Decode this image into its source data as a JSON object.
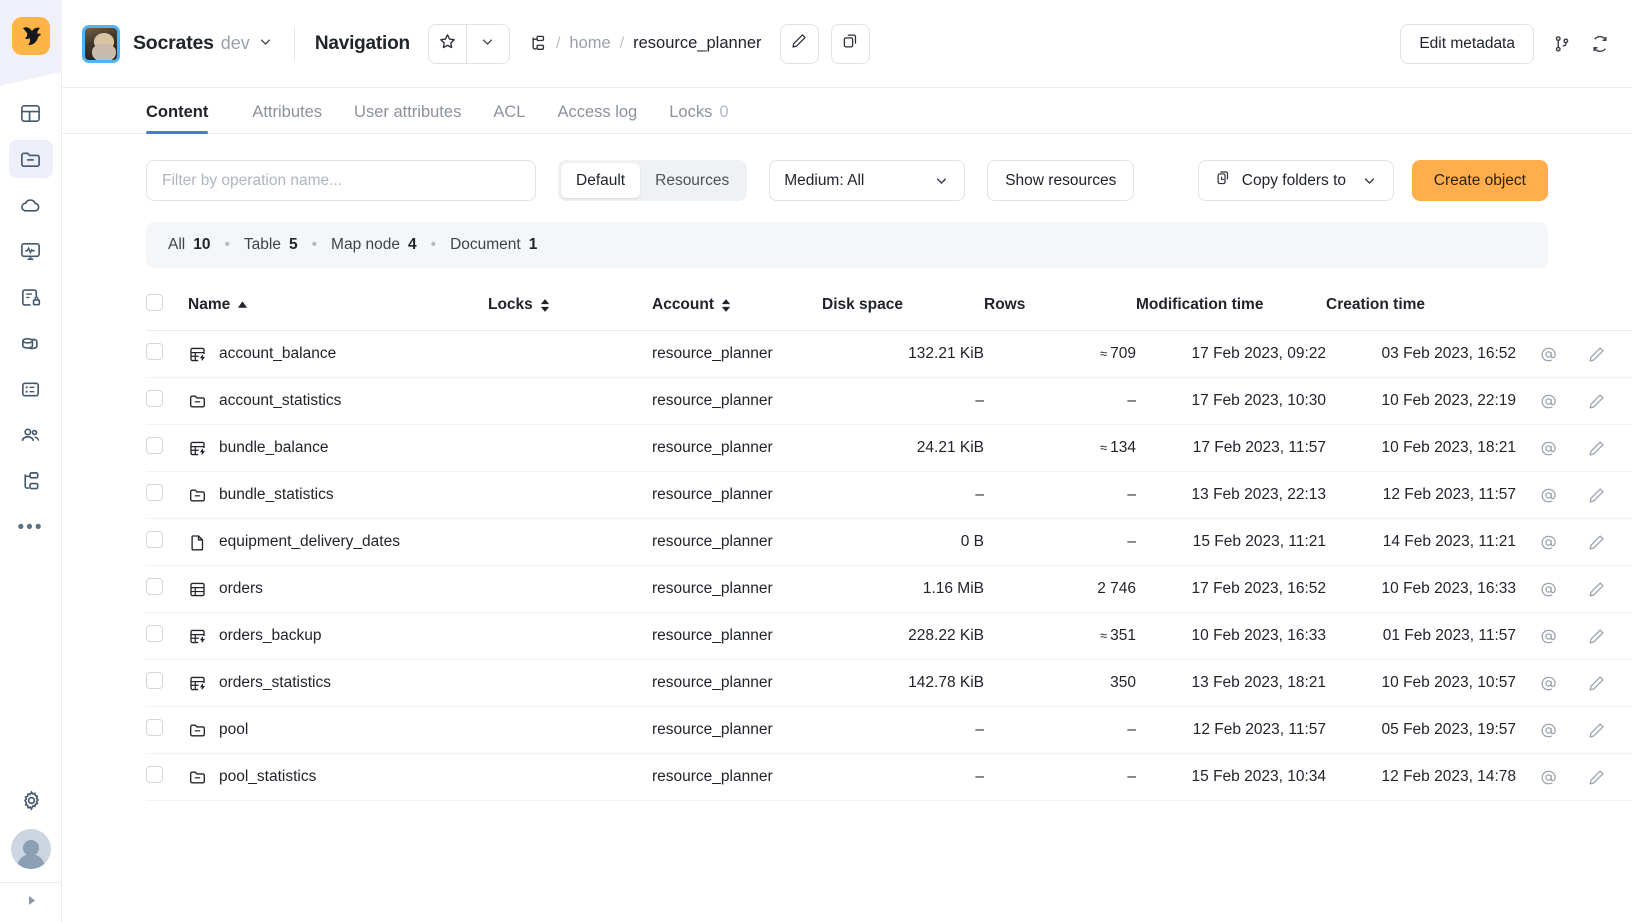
{
  "rail": {
    "logo_icon": "app-logo-icon",
    "items": [
      {
        "icon": "dashboard-icon",
        "name": "sidebar-item-dashboard",
        "active": false
      },
      {
        "icon": "folder-icon",
        "name": "sidebar-item-navigation",
        "active": true
      },
      {
        "icon": "cloud-icon",
        "name": "sidebar-item-cloud",
        "active": false
      },
      {
        "icon": "monitoring-icon",
        "name": "sidebar-item-monitoring",
        "active": false
      },
      {
        "icon": "access-lock-icon",
        "name": "sidebar-item-access",
        "active": false
      },
      {
        "icon": "database-icon",
        "name": "sidebar-item-storage",
        "active": false
      },
      {
        "icon": "server-icon",
        "name": "sidebar-item-server",
        "active": false
      },
      {
        "icon": "users-icon",
        "name": "sidebar-item-users",
        "active": false
      },
      {
        "icon": "tree-icon",
        "name": "sidebar-item-scheduler",
        "active": false
      }
    ],
    "more_label": "•••",
    "settings_icon": "gear-icon",
    "avatar_icon": "user-avatar",
    "collapse_icon": "expand-arrow-icon"
  },
  "header": {
    "project_name": "Socrates",
    "project_env": "dev",
    "project_caret_icon": "chevron-down-icon",
    "nav_title": "Navigation",
    "star_icon": "star-icon",
    "star_caret_icon": "chevron-down-icon",
    "breadcrumb_root_icon": "tree-root-icon",
    "breadcrumb": [
      {
        "label": "home",
        "current": false
      },
      {
        "label": "resource_planner",
        "current": true
      }
    ],
    "separator": "/",
    "edit_icon": "pencil-icon",
    "copy_icon": "copy-path-icon",
    "edit_metadata_label": "Edit metadata",
    "branch_icon": "git-branch-icon",
    "refresh_icon": "refresh-icon"
  },
  "tabs": [
    {
      "label": "Content",
      "count": "",
      "active": true
    },
    {
      "label": "Attributes",
      "count": "",
      "active": false
    },
    {
      "label": "User attributes",
      "count": "",
      "active": false
    },
    {
      "label": "ACL",
      "count": "",
      "active": false
    },
    {
      "label": "Access log",
      "count": "",
      "active": false
    },
    {
      "label": "Locks",
      "count": "0",
      "active": false
    }
  ],
  "toolbar": {
    "filter_placeholder": "Filter by operation name...",
    "filter_value": "",
    "mode_default": "Default",
    "mode_resources": "Resources",
    "mode_active": "Default",
    "medium_select": "Medium:  All",
    "medium_caret_icon": "chevron-down-icon",
    "show_resources_label": "Show resources",
    "copy_folders_label": "Copy folders to",
    "copy_folders_icon": "copy-folders-icon",
    "copy_folders_caret_icon": "chevron-down-icon",
    "create_object_label": "Create object"
  },
  "summary": [
    {
      "label": "All",
      "count": "10"
    },
    {
      "label": "Table",
      "count": "5"
    },
    {
      "label": "Map node",
      "count": "4"
    },
    {
      "label": "Document",
      "count": "1"
    }
  ],
  "summary_dot": "•",
  "table": {
    "columns": [
      {
        "key": "name",
        "label": "Name",
        "sort": "asc"
      },
      {
        "key": "locks",
        "label": "Locks",
        "sort": "both"
      },
      {
        "key": "account",
        "label": "Account",
        "sort": "both"
      },
      {
        "key": "disk_space",
        "label": "Disk space",
        "sort": "none"
      },
      {
        "key": "rows",
        "label": "Rows",
        "sort": "none"
      },
      {
        "key": "modification_time",
        "label": "Modification time",
        "sort": "none"
      },
      {
        "key": "creation_time",
        "label": "Creation time",
        "sort": "none"
      }
    ],
    "row_actions": [
      "at-icon",
      "pencil-icon",
      "trash-icon"
    ],
    "rows": [
      {
        "icon": "table-dynamic-icon",
        "name": "account_balance",
        "locks": "",
        "account": "resource_planner",
        "disk_space": "132.21 KiB",
        "rows": "709",
        "rows_approx": true,
        "modification_time": "17 Feb 2023, 09:22",
        "creation_time": "03 Feb 2023,  16:52"
      },
      {
        "icon": "map-node-icon",
        "name": "account_statistics",
        "locks": "",
        "account": "resource_planner",
        "disk_space": "–",
        "rows": "–",
        "rows_approx": false,
        "modification_time": "17 Feb 2023,  10:30",
        "creation_time": "10 Feb 2023, 22:19"
      },
      {
        "icon": "table-dynamic-icon",
        "name": "bundle_balance",
        "locks": "",
        "account": "resource_planner",
        "disk_space": "24.21 KiB",
        "rows": "134",
        "rows_approx": true,
        "modification_time": "17 Feb 2023, 11:57",
        "creation_time": "10 Feb 2023, 18:21"
      },
      {
        "icon": "map-node-icon",
        "name": "bundle_statistics",
        "locks": "",
        "account": "resource_planner",
        "disk_space": "–",
        "rows": "–",
        "rows_approx": false,
        "modification_time": "13 Feb 2023, 22:13",
        "creation_time": "12 Feb 2023, 11:57"
      },
      {
        "icon": "document-icon",
        "name": "equipment_delivery_dates",
        "locks": "",
        "account": "resource_planner",
        "disk_space": "0 B",
        "rows": "–",
        "rows_approx": false,
        "modification_time": "15 Feb 2023, 11:21",
        "creation_time": "14 Feb 2023, 11:21"
      },
      {
        "icon": "table-static-icon",
        "name": "orders",
        "locks": "",
        "account": "resource_planner",
        "disk_space": "1.16 MiB",
        "rows": "2 746",
        "rows_approx": false,
        "modification_time": "17 Feb 2023, 16:52",
        "creation_time": "10 Feb 2023, 16:33"
      },
      {
        "icon": "table-dynamic-icon",
        "name": "orders_backup",
        "locks": "",
        "account": "resource_planner",
        "disk_space": "228.22 KiB",
        "rows": "351",
        "rows_approx": true,
        "modification_time": "10 Feb 2023, 16:33",
        "creation_time": "01 Feb 2023, 11:57"
      },
      {
        "icon": "table-dynamic-icon",
        "name": "orders_statistics",
        "locks": "",
        "account": "resource_planner",
        "disk_space": "142.78 KiB",
        "rows": "350",
        "rows_approx": false,
        "modification_time": "13 Feb 2023, 18:21",
        "creation_time": "10 Feb 2023, 10:57"
      },
      {
        "icon": "map-node-icon",
        "name": "pool",
        "locks": "",
        "account": "resource_planner",
        "disk_space": "–",
        "rows": "–",
        "rows_approx": false,
        "modification_time": "12 Feb 2023, 11:57",
        "creation_time": "05 Feb 2023, 19:57"
      },
      {
        "icon": "map-node-icon",
        "name": "pool_statistics",
        "locks": "",
        "account": "resource_planner",
        "disk_space": "–",
        "rows": "–",
        "rows_approx": false,
        "modification_time": "15 Feb 2023, 10:34",
        "creation_time": "12 Feb 2023, 14:78"
      }
    ]
  },
  "colors": {
    "accent_orange": "#ffae4b",
    "tab_underline": "#4a7bd4",
    "rail_active": "#eceef9",
    "avatar_border": "#52b4ee"
  }
}
